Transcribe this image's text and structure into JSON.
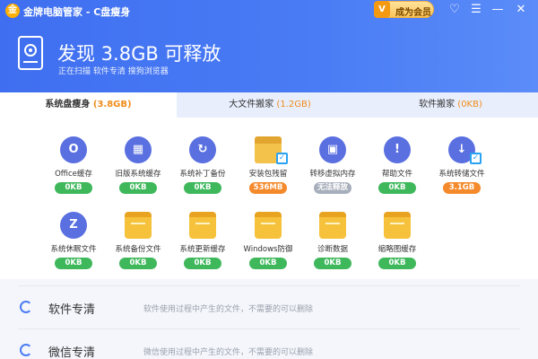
{
  "app": {
    "logo": "金",
    "title": "金牌电脑管家 - C盘瘦身",
    "vip_badge": "V",
    "vip_label": "成为会员"
  },
  "window_controls": {
    "favorite": "♡",
    "menu": "☰",
    "minimize": "—",
    "close": "✕"
  },
  "summary": {
    "headline": "发现 3.8GB 可释放",
    "subline": "正在扫描  软件专清  搜狗浏览器"
  },
  "tabs": [
    {
      "label": "系统盘瘦身",
      "size": "(3.8GB)"
    },
    {
      "label": "大文件搬家",
      "size": "(1.2GB)"
    },
    {
      "label": "软件搬家",
      "size": "(0KB)"
    }
  ],
  "tiles": [
    {
      "label": "Office缓存",
      "size": "0KB",
      "icon": "O",
      "color": "green"
    },
    {
      "label": "旧版系统缓存",
      "size": "0KB",
      "icon": "▦",
      "color": "green"
    },
    {
      "label": "系统补丁备份",
      "size": "0KB",
      "icon": "↻",
      "color": "green"
    },
    {
      "label": "安装包残留",
      "size": "536MB",
      "icon": "",
      "color": "orange"
    },
    {
      "label": "转移虚拟内存",
      "size": "无法释放",
      "icon": "▣",
      "color": "gray"
    },
    {
      "label": "帮助文件",
      "size": "0KB",
      "icon": "!",
      "color": "green"
    },
    {
      "label": "系统转储文件",
      "size": "3.1GB",
      "icon": "↓",
      "color": "orange"
    },
    {
      "label": "系统休眠文件",
      "size": "0KB",
      "icon": "Z",
      "color": "green"
    },
    {
      "label": "系统备份文件",
      "size": "0KB",
      "icon": "",
      "color": "green"
    },
    {
      "label": "系统更新缓存",
      "size": "0KB",
      "icon": "",
      "color": "green"
    },
    {
      "label": "Windows防御",
      "size": "0KB",
      "icon": "",
      "color": "green"
    },
    {
      "label": "诊断数据",
      "size": "0KB",
      "icon": "",
      "color": "green"
    },
    {
      "label": "缩略图缓存",
      "size": "0KB",
      "icon": "",
      "color": "green"
    }
  ],
  "check_mark": "✓",
  "sections": [
    {
      "title": "软件专清",
      "desc": "软件使用过程中产生的文件，不需要的可以删除"
    },
    {
      "title": "微信专清",
      "desc": "微信使用过程中产生的文件，不需要的可以删除"
    }
  ],
  "colors": {
    "accent": "#4a7cf5",
    "green": "#3fb85c",
    "orange": "#f58a2c",
    "gray": "#a8afbc"
  }
}
